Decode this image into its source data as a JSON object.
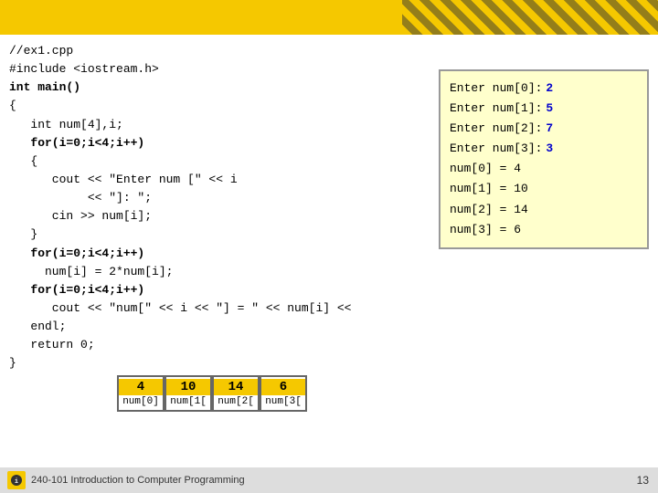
{
  "header": {
    "title": "//ex1.cpp",
    "subtitle": "#include <iostream.h>"
  },
  "code": {
    "lines": [
      "//ex1.cpp",
      "#include <iostream.h>",
      "int main()",
      "{",
      "   int num[4],i;",
      "   for(i=0;i<4;i++)",
      "   {",
      "      cout << \"Enter num [\" << i",
      "           << \"]: \";",
      "      cin >> num[i];",
      "   }",
      "   for(i=0;i<4;i++)",
      "     num[i] = 2*num[i];",
      "   for(i=0;i<4;i++)",
      "      cout << \"num[\" << i << \"] = \" << num[i] <<",
      "   endl;",
      "   return 0;",
      "}"
    ],
    "bold_lines": [
      2,
      5,
      11,
      13
    ]
  },
  "output": {
    "lines": [
      {
        "label": "Enter num[0]:",
        "value": "2"
      },
      {
        "label": "Enter num[1]:",
        "value": "5"
      },
      {
        "label": "Enter num[2]:",
        "value": "7"
      },
      {
        "label": "Enter num[3]:",
        "value": "3"
      },
      {
        "label": "num[0] = 4",
        "value": ""
      },
      {
        "label": "num[1] = 10",
        "value": ""
      },
      {
        "label": "num[2] = 14",
        "value": ""
      },
      {
        "label": "num[3] = 6",
        "value": ""
      }
    ]
  },
  "array_cells": [
    {
      "value": "4",
      "label": "num[0]"
    },
    {
      "value": "10",
      "label": "num[1["
    },
    {
      "value": "14",
      "label": "num[2["
    },
    {
      "value": "6",
      "label": "num[3["
    }
  ],
  "footer": {
    "course": "240-101 Introduction to Computer Programming",
    "page": "13"
  }
}
